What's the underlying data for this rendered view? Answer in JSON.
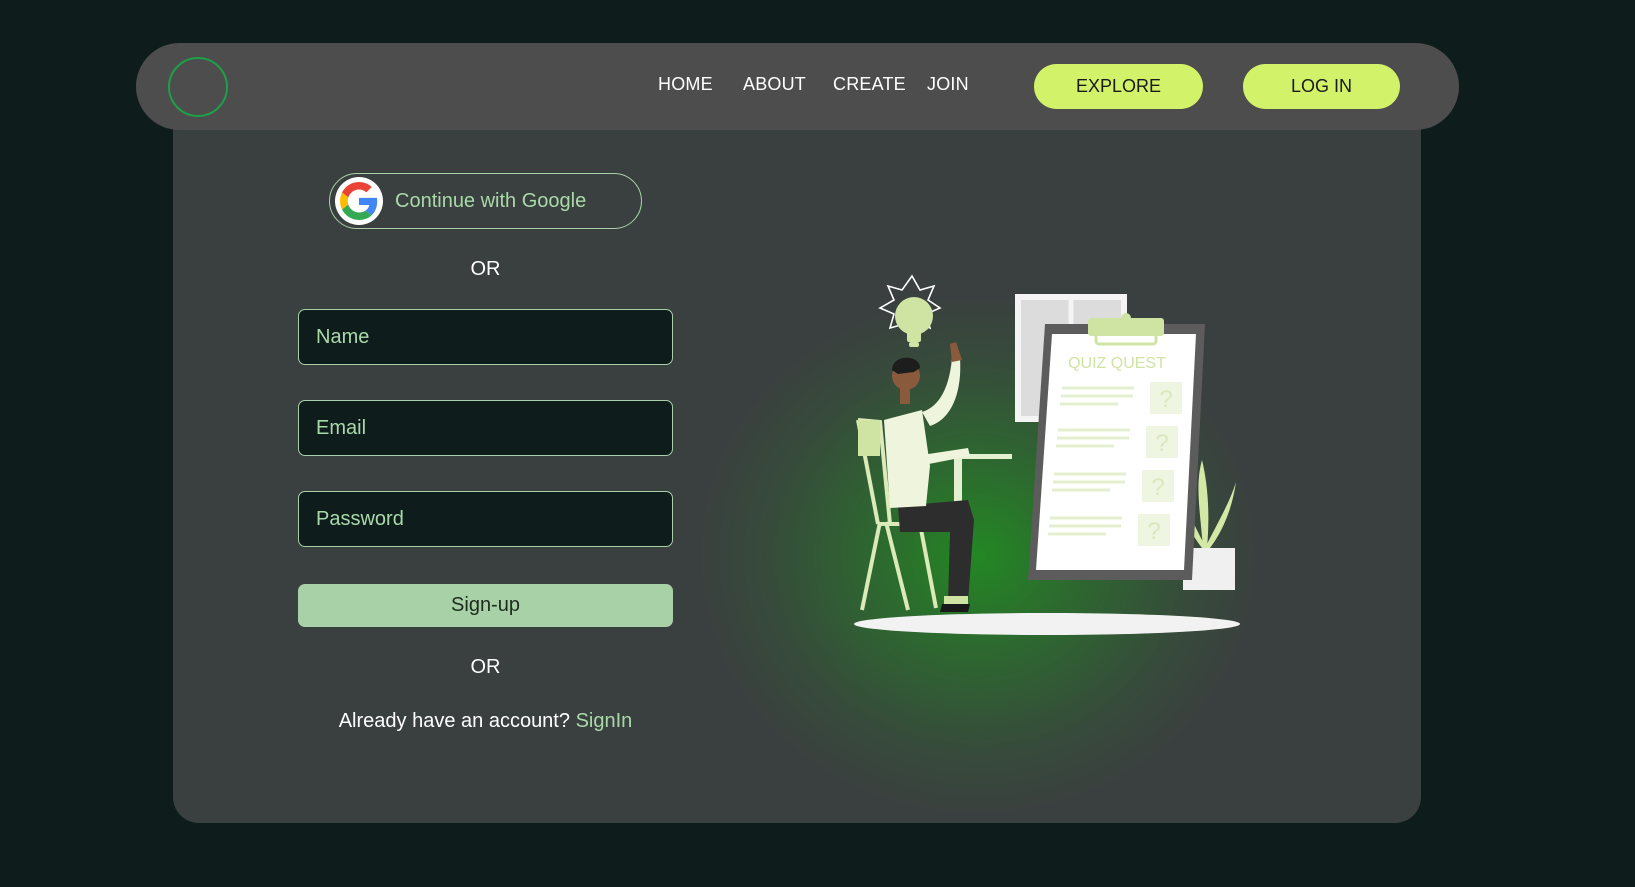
{
  "colors": {
    "page_background": "#0f1c1c",
    "card_background": "#3a403f",
    "navbar_background": "#4d4d4d",
    "accent_lime": "#d2f26a",
    "accent_mint": "#a8d1a8",
    "logo_ring": "#1e9f4a",
    "glow_green": "#228b22"
  },
  "navbar": {
    "logo_icon": "circle-logo",
    "links": [
      "HOME",
      "ABOUT",
      "CREATE",
      "JOIN"
    ],
    "explore_label": "EXPLORE",
    "login_label": "LOG IN"
  },
  "form": {
    "google_icon": "google-g-icon",
    "google_label": "Continue with Google",
    "or_top": "OR",
    "name_placeholder": "Name",
    "email_placeholder": "Email",
    "password_placeholder": "Password",
    "signup_label": "Sign-up",
    "or_bottom": "OR",
    "account_prompt": "Already have an account?",
    "signin_label": "SignIn"
  },
  "illustration": {
    "clipboard_title": "QUIZ QUEST",
    "question_marks": [
      "?",
      "?",
      "?",
      "?"
    ]
  }
}
